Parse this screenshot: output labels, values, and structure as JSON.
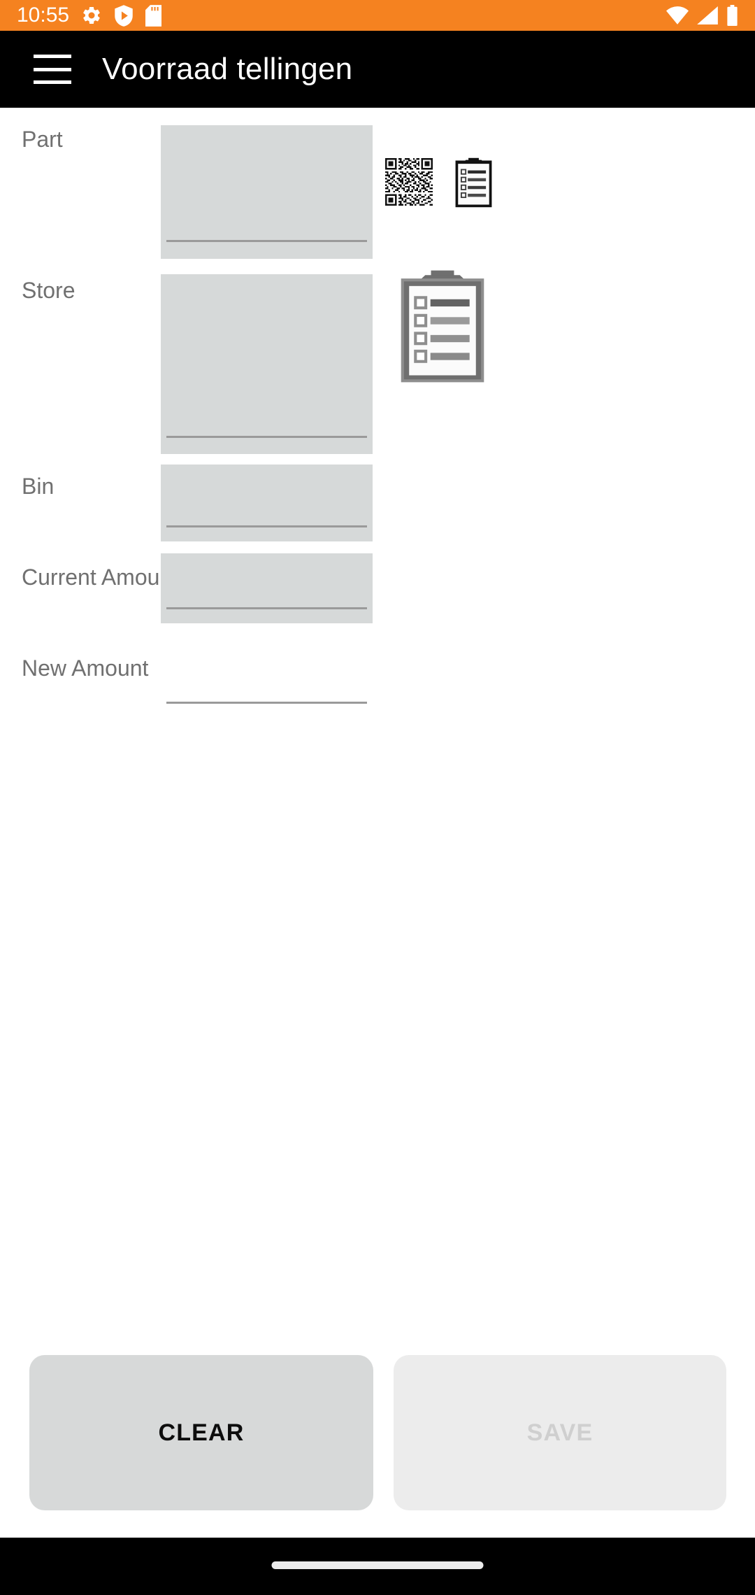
{
  "status_bar": {
    "time": "10:55",
    "background_color": "#f58220",
    "left_icons": [
      "gear-icon",
      "play-protect-shield-icon",
      "sd-card-icon"
    ],
    "right_icons": [
      "wifi-icon",
      "cellular-signal-icon",
      "battery-icon"
    ]
  },
  "app_bar": {
    "menu_icon": "hamburger-menu-icon",
    "title": "Voorraad tellingen",
    "background_color": "#000000",
    "text_color": "#ffffff"
  },
  "form": {
    "rows": [
      {
        "label": "Part",
        "value": "",
        "placeholder": "",
        "enabled": false,
        "field_bg": "#d6d9d9",
        "actions": [
          "qr-scan-icon",
          "list-picker-icon"
        ]
      },
      {
        "label": "Store",
        "value": "",
        "placeholder": "",
        "enabled": false,
        "field_bg": "#d6d9d9",
        "actions": [
          "clipboard-list-icon"
        ]
      },
      {
        "label": "Bin",
        "value": "",
        "placeholder": "",
        "enabled": false,
        "field_bg": "#d6d9d9",
        "actions": []
      },
      {
        "label": "Current Amount",
        "value": "",
        "placeholder": "",
        "enabled": false,
        "field_bg": "#d6d9d9",
        "actions": []
      },
      {
        "label": "New Amount",
        "value": "",
        "placeholder": "",
        "enabled": true,
        "field_bg": "transparent",
        "actions": []
      }
    ],
    "label_color": "#707070",
    "underline_color": "#9a9a9a"
  },
  "buttons": {
    "clear_label": "CLEAR",
    "save_label": "SAVE",
    "clear_bg": "#d7d9d9",
    "clear_text": "#0d0d0d",
    "save_bg": "#ececec",
    "save_text": "#cfcfcf",
    "save_enabled": false
  },
  "nav_bar": {
    "background_color": "#000000",
    "gesture_pill_color": "#ececec"
  }
}
